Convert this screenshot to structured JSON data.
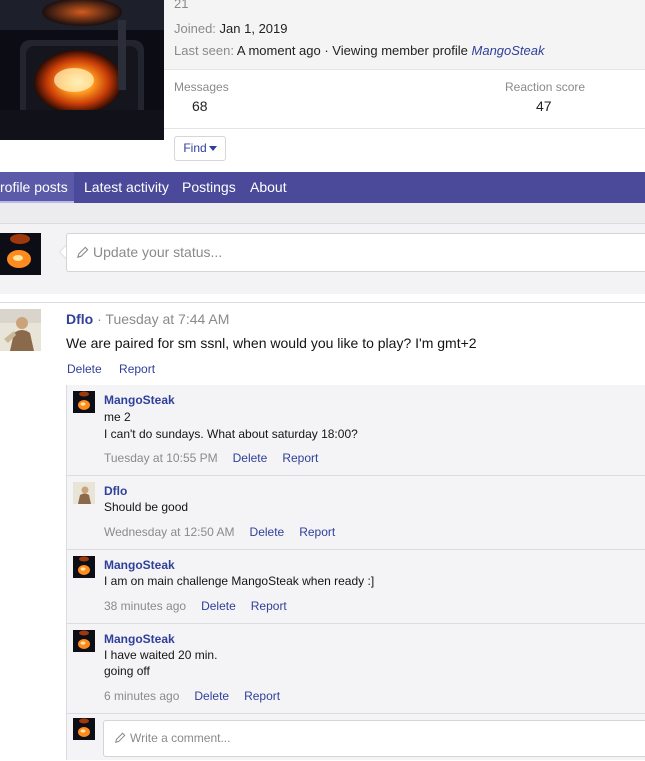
{
  "colors": {
    "accent": "#4b4a9a",
    "link": "#2f3f9a",
    "muted": "#8a8a8a"
  },
  "profile": {
    "partial_top": "21",
    "joined_label": "Joined:",
    "joined_value": "Jan 1, 2019",
    "last_seen_label": "Last seen:",
    "last_seen_value": "A moment ago · Viewing member profile",
    "last_seen_member": "MangoSteak",
    "messages_label": "Messages",
    "messages_value": "68",
    "reaction_label": "Reaction score",
    "reaction_value": "47",
    "find_label": "Find"
  },
  "tabs": [
    {
      "label": "rofile posts"
    },
    {
      "label": "Latest activity"
    },
    {
      "label": "Postings"
    },
    {
      "label": "About"
    }
  ],
  "status": {
    "placeholder": "Update your status..."
  },
  "post": {
    "author": "Dflo",
    "time": "· Tuesday at 7:44 AM",
    "body": "We are paired for sm ssnl, when would you like to play? I'm gmt+2",
    "delete_label": "Delete",
    "report_label": "Report"
  },
  "comments": [
    {
      "author": "MangoSteak",
      "lines": [
        "me 2",
        "I can't do sundays. What about saturday 18:00?"
      ],
      "time": "Tuesday at 10:55 PM",
      "delete": "Delete",
      "report": "Report"
    },
    {
      "author": "Dflo",
      "lines": [
        "Should be good"
      ],
      "time": "Wednesday at 12:50 AM",
      "delete": "Delete",
      "report": "Report"
    },
    {
      "author": "MangoSteak",
      "lines": [
        "I am on main challenge MangoSteak when ready :]"
      ],
      "time": "38 minutes ago",
      "delete": "Delete",
      "report": "Report"
    },
    {
      "author": "MangoSteak",
      "lines": [
        "I have waited 20 min.",
        "going off"
      ],
      "time": "6 minutes ago",
      "delete": "Delete",
      "report": "Report"
    }
  ],
  "comment_box": {
    "placeholder": "Write a comment..."
  }
}
